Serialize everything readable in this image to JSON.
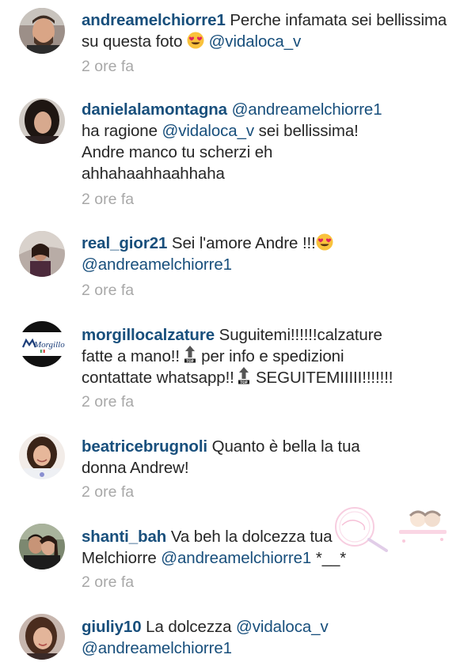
{
  "comments": [
    {
      "username": "andreamelchiorre1",
      "body_parts": [
        " Perche infamata sei bellissima su questa foto ",
        "@vidaloca_v"
      ],
      "emoji": "heart-eyes",
      "time": "2 ore fa"
    },
    {
      "username": "danielalamontagna",
      "mention1": "@andreamelchiorre1",
      "line2a": "ha ragione ",
      "mention2": "@vidaloca_v",
      "line2b": " sei bellissima!",
      "line3": "Andre manco tu scherzi eh",
      "line4": "ahhahaahhaahhaha",
      "time": "2 ore fa"
    },
    {
      "username": "real_gior21",
      "body": " Sei l'amore Andre !!!",
      "mention": "@andreamelchiorre1",
      "emoji": "heart-eyes",
      "time": "2 ore fa"
    },
    {
      "username": "morgillocalzature",
      "body1": " Suguitemi!!!!!!calzature",
      "body2": "fatte a mano!!",
      "body2b": " per info e spedizioni",
      "body3": "contattate whatsapp!!",
      "body3b": " SEGUITEMIIIII!!!!!!!",
      "avatar_logo": "Morgillo",
      "icon_label": "TOP",
      "time": "2 ore fa"
    },
    {
      "username": "beatricebrugnoli",
      "body1": " Quanto è bella la tua",
      "body2": "donna Andrew!",
      "time": "2 ore fa"
    },
    {
      "username": "shanti_bah",
      "body1": " Va beh la dolcezza tua",
      "body2": "Melchiorre ",
      "mention": "@andreamelchiorre1",
      "body2b": " *__*",
      "time": "2 ore fa"
    },
    {
      "username": "giuliy10",
      "body1": " La dolcezza ",
      "mention1": "@vidaloca_v",
      "mention2": "@andreamelchiorre1"
    }
  ],
  "colors": {
    "username": "#184f7c",
    "text": "#262626",
    "time": "#a8a8a8",
    "background": "#ffffff"
  }
}
